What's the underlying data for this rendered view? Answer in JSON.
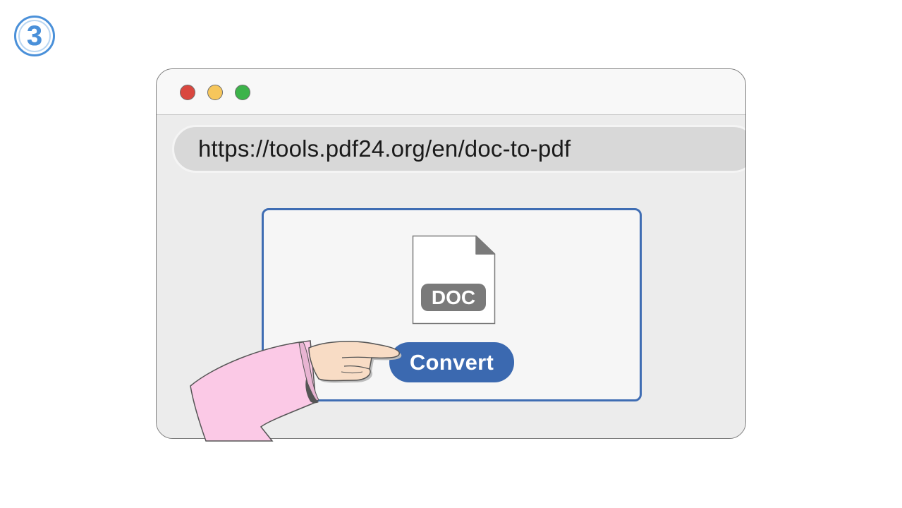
{
  "step": {
    "number": "3"
  },
  "browser": {
    "window_controls": {
      "close_color": "#d9473f",
      "minimize_color": "#f6c65b",
      "maximize_color": "#3cb34a"
    },
    "address_bar": {
      "url": "https://tools.pdf24.org/en/doc-to-pdf"
    }
  },
  "upload_panel": {
    "file": {
      "icon": "document-file-icon",
      "type_label": "DOC"
    },
    "convert_button": {
      "label": "Convert",
      "color": "#3b69b0"
    },
    "border_color": "#3f6db3"
  },
  "illustration": {
    "pointer": "hand-pointer-icon",
    "sleeve_color": "#fbc9e6"
  }
}
